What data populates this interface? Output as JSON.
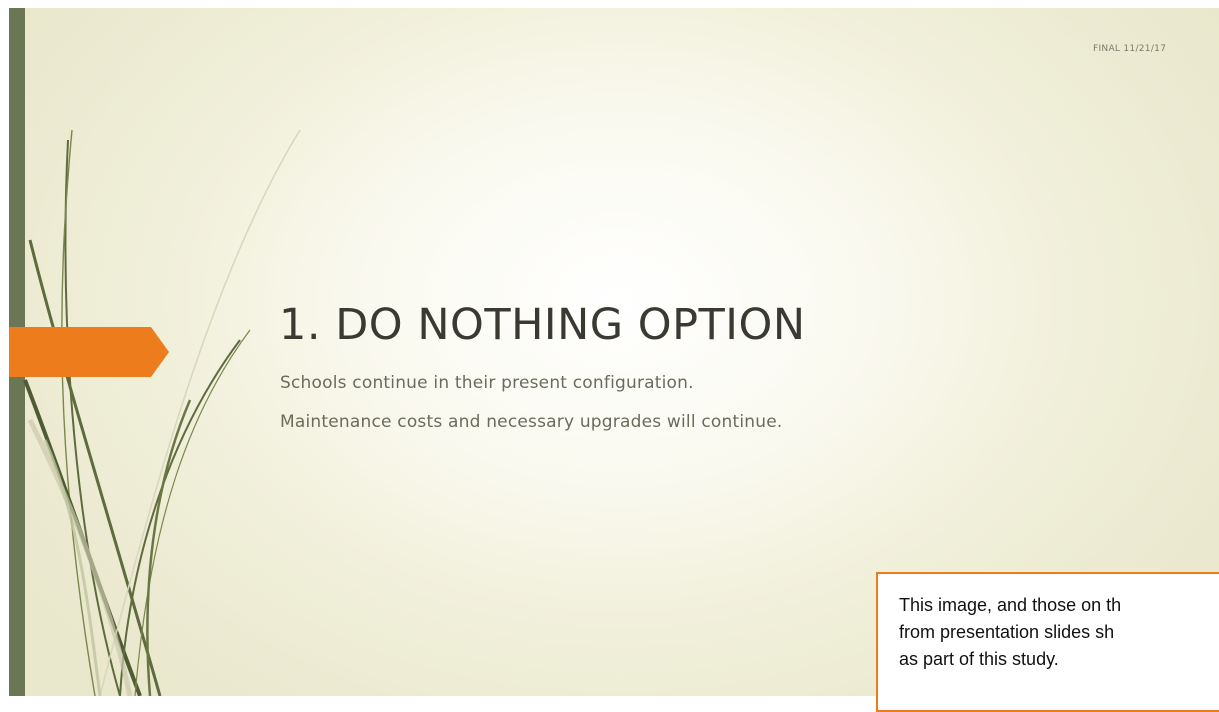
{
  "slide": {
    "date_stamp": "FINAL 11/21/17",
    "title": "1. DO NOTHING OPTION",
    "subtitle_lines": [
      "Schools continue in their present configuration.",
      "Maintenance costs and necessary upgrades will continue."
    ]
  },
  "note_box": {
    "lines": [
      "This image, and those on th",
      "from presentation slides sh",
      "as part of this study."
    ]
  },
  "colors": {
    "left_bar": "#6b7654",
    "accent_orange": "#ed7d1c",
    "title_text": "#3a3a32",
    "subtitle_text": "#6b6b5c"
  },
  "icons": {
    "arrow": "orange-pentagon-arrow",
    "decoration": "grass-blades"
  }
}
